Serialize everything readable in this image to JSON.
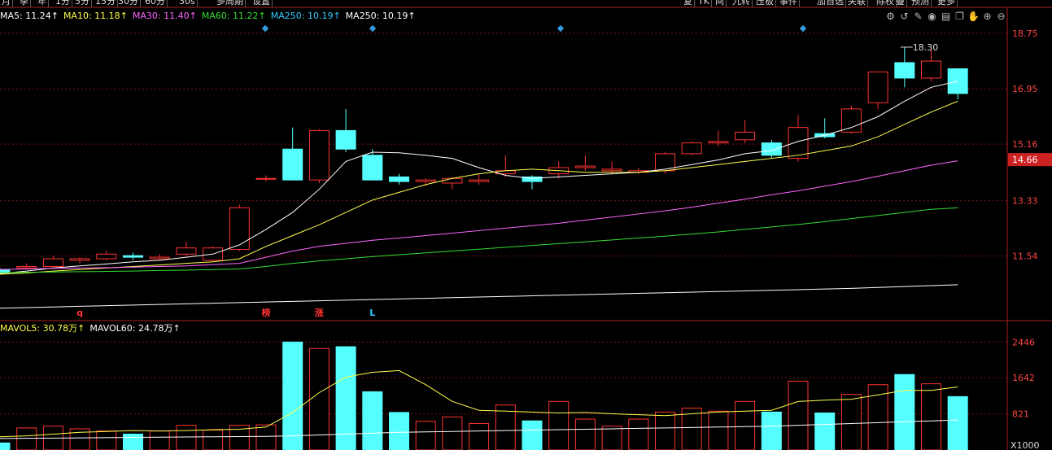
{
  "topbar": {
    "period_buttons": [
      "月",
      "季",
      "年",
      "1分",
      "5分",
      "15分",
      "30分",
      "60分",
      "30s",
      "多周期",
      "设置"
    ],
    "right_buttons": [
      "复",
      "TK",
      "间",
      "九转",
      "压板",
      "事件",
      "加自选",
      "关联",
      "除权",
      "叠",
      "预测",
      "更多"
    ]
  },
  "ma_legend": [
    {
      "label": "MA5: 11.24↑",
      "color": "#ffffff"
    },
    {
      "label": "MA10: 11.18↑",
      "color": "#ffff4d"
    },
    {
      "label": "MA30: 11.40↑",
      "color": "#ff66ff"
    },
    {
      "label": "MA60: 11.22↑",
      "color": "#33dd33"
    },
    {
      "label": "MA250: 10.19↑",
      "color": "#33ccff"
    },
    {
      "label": "MA250: 10.19↑",
      "color": "#ffffff"
    }
  ],
  "vol_legend": [
    {
      "label": "MAVOL5: 30.78万↑",
      "color": "#ffff4d"
    },
    {
      "label": "MAVOL60: 24.78万↑",
      "color": "#ffffff"
    }
  ],
  "toolbar_icons": [
    "settings-icon",
    "undo-icon",
    "edit-icon",
    "eye-icon",
    "trash-icon",
    "copy-icon",
    "hand-icon",
    "zoom-in-icon",
    "zoom-out-icon"
  ],
  "price_axis": {
    "ticks": [
      "18.75",
      "16.95",
      "15.16",
      "13.33",
      "11.54"
    ],
    "current_price": "14.66",
    "max_label": "18.30"
  },
  "volume_axis": {
    "ticks": [
      "2446",
      "1642",
      "821"
    ],
    "unit": "X1000"
  },
  "markers": [
    {
      "text": "q",
      "color": "#ff3333"
    },
    {
      "text": "榜",
      "color": "#ff3333"
    },
    {
      "text": "涨",
      "color": "#ff3333"
    },
    {
      "text": "L",
      "color": "#33ccff"
    }
  ],
  "colors": {
    "up": "#ff3333",
    "down": "#55ffff",
    "grid": "#7a1010",
    "axis": "#aa2222"
  },
  "chart_data": {
    "type": "candlestick",
    "ylim": [
      9.5,
      19.3
    ],
    "volume_ylim": [
      0,
      2600
    ],
    "candles": [
      {
        "o": 11.1,
        "h": 11.15,
        "l": 10.95,
        "c": 11.0,
        "v": 160,
        "mark": ""
      },
      {
        "o": 11.15,
        "h": 11.3,
        "l": 11.1,
        "c": 11.2,
        "v": 500,
        "mark": ""
      },
      {
        "o": 11.2,
        "h": 11.55,
        "l": 11.15,
        "c": 11.45,
        "v": 540,
        "mark": ""
      },
      {
        "o": 11.4,
        "h": 11.5,
        "l": 11.3,
        "c": 11.45,
        "v": 480,
        "mark": "q"
      },
      {
        "o": 11.45,
        "h": 11.7,
        "l": 11.4,
        "c": 11.6,
        "v": 430,
        "mark": ""
      },
      {
        "o": 11.55,
        "h": 11.65,
        "l": 11.4,
        "c": 11.5,
        "v": 360,
        "mark": ""
      },
      {
        "o": 11.45,
        "h": 11.6,
        "l": 11.4,
        "c": 11.5,
        "v": 430,
        "mark": ""
      },
      {
        "o": 11.6,
        "h": 12.0,
        "l": 11.55,
        "c": 11.8,
        "v": 560,
        "mark": ""
      },
      {
        "o": 11.4,
        "h": 11.85,
        "l": 11.35,
        "c": 11.8,
        "v": 450,
        "mark": ""
      },
      {
        "o": 11.75,
        "h": 13.2,
        "l": 11.7,
        "c": 13.1,
        "v": 560,
        "mark": ""
      },
      {
        "o": 14.05,
        "h": 14.15,
        "l": 13.95,
        "c": 14.05,
        "v": 570,
        "mark": "榜"
      },
      {
        "o": 15.0,
        "h": 15.7,
        "l": 14.0,
        "c": 14.0,
        "v": 2446,
        "mark": ""
      },
      {
        "o": 14.0,
        "h": 15.65,
        "l": 13.9,
        "c": 15.6,
        "v": 2300,
        "mark": "涨"
      },
      {
        "o": 15.6,
        "h": 16.3,
        "l": 14.9,
        "c": 15.0,
        "v": 2340,
        "mark": ""
      },
      {
        "o": 14.8,
        "h": 15.0,
        "l": 14.0,
        "c": 14.0,
        "v": 1320,
        "mark": "L"
      },
      {
        "o": 14.1,
        "h": 14.2,
        "l": 13.85,
        "c": 13.95,
        "v": 850,
        "mark": ""
      },
      {
        "o": 13.95,
        "h": 14.05,
        "l": 13.8,
        "c": 14.0,
        "v": 650,
        "mark": ""
      },
      {
        "o": 13.9,
        "h": 14.1,
        "l": 13.7,
        "c": 14.05,
        "v": 750,
        "mark": ""
      },
      {
        "o": 13.95,
        "h": 14.2,
        "l": 13.85,
        "c": 14.0,
        "v": 600,
        "mark": ""
      },
      {
        "o": 14.2,
        "h": 14.8,
        "l": 14.1,
        "c": 14.3,
        "v": 1020,
        "mark": ""
      },
      {
        "o": 14.1,
        "h": 14.15,
        "l": 13.7,
        "c": 13.95,
        "v": 660,
        "mark": ""
      },
      {
        "o": 14.2,
        "h": 14.6,
        "l": 14.05,
        "c": 14.4,
        "v": 1100,
        "mark": ""
      },
      {
        "o": 14.4,
        "h": 14.8,
        "l": 14.3,
        "c": 14.45,
        "v": 700,
        "mark": ""
      },
      {
        "o": 14.3,
        "h": 14.6,
        "l": 14.2,
        "c": 14.35,
        "v": 540,
        "mark": ""
      },
      {
        "o": 14.25,
        "h": 14.4,
        "l": 14.2,
        "c": 14.3,
        "v": 700,
        "mark": ""
      },
      {
        "o": 14.3,
        "h": 14.9,
        "l": 14.2,
        "c": 14.85,
        "v": 860,
        "mark": ""
      },
      {
        "o": 14.85,
        "h": 15.25,
        "l": 14.8,
        "c": 15.2,
        "v": 950,
        "mark": ""
      },
      {
        "o": 15.2,
        "h": 15.6,
        "l": 15.1,
        "c": 15.25,
        "v": 880,
        "mark": ""
      },
      {
        "o": 15.3,
        "h": 15.95,
        "l": 15.2,
        "c": 15.55,
        "v": 1100,
        "mark": ""
      },
      {
        "o": 15.2,
        "h": 15.3,
        "l": 14.7,
        "c": 14.8,
        "v": 860,
        "mark": ""
      },
      {
        "o": 14.7,
        "h": 16.1,
        "l": 14.6,
        "c": 15.7,
        "v": 1560,
        "mark": ""
      },
      {
        "o": 15.5,
        "h": 16.0,
        "l": 15.35,
        "c": 15.4,
        "v": 840,
        "mark": ""
      },
      {
        "o": 15.55,
        "h": 16.4,
        "l": 15.5,
        "c": 16.3,
        "v": 1260,
        "mark": ""
      },
      {
        "o": 16.5,
        "h": 17.5,
        "l": 16.3,
        "c": 17.5,
        "v": 1480,
        "mark": ""
      },
      {
        "o": 17.8,
        "h": 18.3,
        "l": 17.0,
        "c": 17.3,
        "v": 1710,
        "mark": ""
      },
      {
        "o": 17.3,
        "h": 18.3,
        "l": 17.2,
        "c": 17.85,
        "v": 1500,
        "mark": ""
      },
      {
        "o": 17.6,
        "h": 17.6,
        "l": 16.6,
        "c": 16.8,
        "v": 1210,
        "mark": ""
      }
    ],
    "ma_series": [
      {
        "name": "MA5",
        "color": "#ffffff",
        "values": [
          10.97,
          11.05,
          11.15,
          11.22,
          11.28,
          11.35,
          11.4,
          11.5,
          11.6,
          11.9,
          12.4,
          12.95,
          13.7,
          14.6,
          14.9,
          14.88,
          14.8,
          14.7,
          14.4,
          14.15,
          14.05,
          14.1,
          14.15,
          14.2,
          14.25,
          14.35,
          14.5,
          14.65,
          14.85,
          14.95,
          15.25,
          15.45,
          15.7,
          16.05,
          16.55,
          17.0,
          17.2
        ]
      },
      {
        "name": "MA10",
        "color": "#ffff4d",
        "values": [
          10.95,
          10.99,
          11.05,
          11.1,
          11.15,
          11.2,
          11.25,
          11.3,
          11.35,
          11.45,
          11.85,
          12.2,
          12.55,
          12.95,
          13.35,
          13.6,
          13.85,
          14.05,
          14.2,
          14.3,
          14.35,
          14.3,
          14.25,
          14.25,
          14.25,
          14.3,
          14.4,
          14.5,
          14.6,
          14.7,
          14.8,
          14.95,
          15.1,
          15.4,
          15.8,
          16.2,
          16.55
        ]
      },
      {
        "name": "MA30",
        "color": "#ff66ff",
        "values": [
          11.1,
          11.12,
          11.14,
          11.15,
          11.16,
          11.18,
          11.2,
          11.22,
          11.26,
          11.3,
          11.5,
          11.7,
          11.85,
          11.95,
          12.05,
          12.12,
          12.2,
          12.28,
          12.36,
          12.44,
          12.52,
          12.6,
          12.7,
          12.8,
          12.9,
          13.0,
          13.12,
          13.25,
          13.38,
          13.52,
          13.65,
          13.8,
          13.95,
          14.12,
          14.3,
          14.48,
          14.62
        ]
      },
      {
        "name": "MA60",
        "color": "#33dd33",
        "values": [
          11.0,
          11.01,
          11.02,
          11.03,
          11.04,
          11.05,
          11.07,
          11.08,
          11.1,
          11.12,
          11.2,
          11.3,
          11.38,
          11.45,
          11.52,
          11.58,
          11.64,
          11.7,
          11.76,
          11.82,
          11.88,
          11.94,
          12.0,
          12.06,
          12.12,
          12.18,
          12.25,
          12.32,
          12.4,
          12.48,
          12.56,
          12.65,
          12.75,
          12.85,
          12.95,
          13.05,
          13.1
        ]
      },
      {
        "name": "MA250",
        "color": "#ffffff",
        "values": [
          9.85,
          9.87,
          9.89,
          9.91,
          9.93,
          9.95,
          9.97,
          9.99,
          10.01,
          10.03,
          10.05,
          10.07,
          10.09,
          10.11,
          10.13,
          10.15,
          10.17,
          10.19,
          10.21,
          10.23,
          10.25,
          10.27,
          10.29,
          10.31,
          10.33,
          10.35,
          10.37,
          10.39,
          10.41,
          10.43,
          10.45,
          10.47,
          10.49,
          10.52,
          10.55,
          10.58,
          10.61
        ]
      }
    ],
    "mavol_series": [
      {
        "name": "MAVOL5",
        "color": "#ffff4d",
        "values": [
          300,
          320,
          360,
          400,
          420,
          440,
          430,
          440,
          460,
          470,
          520,
          850,
          1300,
          1650,
          1760,
          1800,
          1480,
          1100,
          900,
          880,
          860,
          840,
          850,
          820,
          800,
          780,
          820,
          860,
          880,
          900,
          1100,
          1130,
          1150,
          1250,
          1350,
          1350,
          1430
        ]
      },
      {
        "name": "MAVOL60",
        "color": "#ffffff",
        "values": [
          260,
          265,
          270,
          275,
          280,
          285,
          290,
          295,
          300,
          305,
          310,
          320,
          340,
          360,
          380,
          400,
          410,
          420,
          430,
          440,
          450,
          460,
          470,
          480,
          490,
          500,
          510,
          520,
          530,
          540,
          560,
          580,
          600,
          620,
          640,
          660,
          680
        ]
      }
    ]
  }
}
